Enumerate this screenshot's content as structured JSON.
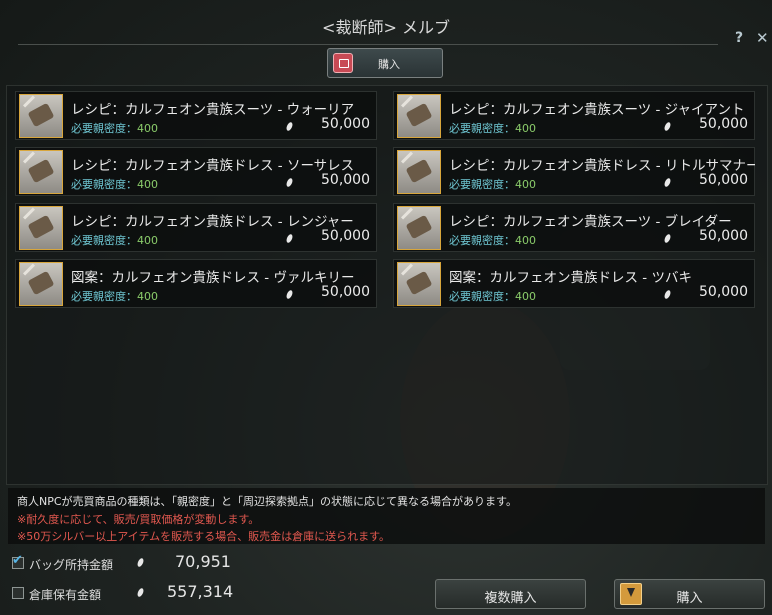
{
  "window": {
    "title": "<裁断師> メルブ",
    "help_glyph": "?",
    "close_glyph": "╲"
  },
  "tab": {
    "label": "購入"
  },
  "items": [
    {
      "name": "レシピ：カルフェオン貴族スーツ - ウォーリア",
      "req_label": "必要親密度：",
      "req_value": "400",
      "price": "50,000"
    },
    {
      "name": "レシピ：カルフェオン貴族スーツ - ジャイアント",
      "req_label": "必要親密度：",
      "req_value": "400",
      "price": "50,000"
    },
    {
      "name": "レシピ：カルフェオン貴族ドレス - ソーサレス",
      "req_label": "必要親密度：",
      "req_value": "400",
      "price": "50,000"
    },
    {
      "name": "レシピ：カルフェオン貴族ドレス - リトルサマナー",
      "req_label": "必要親密度：",
      "req_value": "400",
      "price": "50,000"
    },
    {
      "name": "レシピ：カルフェオン貴族ドレス - レンジャー",
      "req_label": "必要親密度：",
      "req_value": "400",
      "price": "50,000"
    },
    {
      "name": "レシピ：カルフェオン貴族スーツ - ブレイダー",
      "req_label": "必要親密度：",
      "req_value": "400",
      "price": "50,000"
    },
    {
      "name": "図案：カルフェオン貴族ドレス - ヴァルキリー",
      "req_label": "必要親密度：",
      "req_value": "400",
      "price": "50,000"
    },
    {
      "name": "図案：カルフェオン貴族ドレス - ツバキ",
      "req_label": "必要親密度：",
      "req_value": "400",
      "price": "50,000"
    }
  ],
  "notice": {
    "line1": "商人NPCが売買商品の種類は、「親密度」と「周辺探索拠点」の状態に応じて異なる場合があります。",
    "line2": "※耐久度に応じて、販売/買取価格が変動します。",
    "line3": "※50万シルバー以上アイテムを販売する場合、販売金は倉庫に送られます。"
  },
  "money": {
    "bag_label": "バッグ所持金額",
    "bag_value": "70,951",
    "bag_checked": true,
    "storage_label": "倉庫保有金額",
    "storage_value": "557,314",
    "storage_checked": false
  },
  "buttons": {
    "multi_buy": "複数購入",
    "buy": "購入"
  },
  "colors": {
    "req_label": "#6fc7d3",
    "req_value": "#8acb6a",
    "warning": "#e2584f",
    "frame_gold": "#d8a63c"
  }
}
